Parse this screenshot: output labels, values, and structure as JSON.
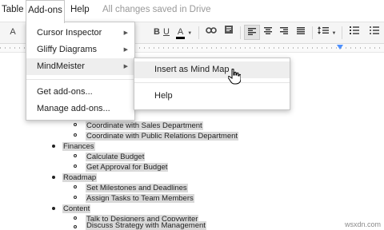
{
  "menubar": {
    "table": "Table",
    "addons": "Add-ons",
    "help": "Help",
    "saved_status": "All changes saved in Drive"
  },
  "toolbar": {
    "font_size_fragment": "A",
    "bold": "B",
    "italic": "I",
    "underline": "U",
    "text_color": "A",
    "active_alignment": "left"
  },
  "addons_menu": {
    "items": [
      {
        "label": "Cursor Inspector",
        "has_submenu": true
      },
      {
        "label": "Gliffy Diagrams",
        "has_submenu": true
      },
      {
        "label": "MindMeister",
        "has_submenu": true,
        "highlighted": true
      },
      {
        "label": "Get add-ons..."
      },
      {
        "label": "Manage add-ons..."
      }
    ]
  },
  "mindmeister_submenu": {
    "items": [
      {
        "label": "Insert as Mind Map",
        "highlighted": true
      },
      {
        "label": "Help"
      }
    ]
  },
  "document": {
    "outline": [
      {
        "level": 2,
        "text": "Coordinate with Sales Department"
      },
      {
        "level": 2,
        "text": "Coordinate with Public Relations Department"
      },
      {
        "level": 1,
        "text": "Finances"
      },
      {
        "level": 2,
        "text": "Calculate Budget"
      },
      {
        "level": 2,
        "text": "Get Approval for Budget"
      },
      {
        "level": 1,
        "text": "Roadmap"
      },
      {
        "level": 2,
        "text": "Set Milestones and Deadlines"
      },
      {
        "level": 2,
        "text": "Assign Tasks to Team Members"
      },
      {
        "level": 1,
        "text": "Content"
      },
      {
        "level": 2,
        "text": "Talk to Designers and Copywriter"
      },
      {
        "level": 2,
        "text": "Discuss Strategy with Management"
      }
    ]
  },
  "watermark": "wsxdn.com",
  "colors": {
    "selection": "#d9d9d9",
    "menu_highlight": "#eeeeee",
    "saved_status": "#999999",
    "ruler_marker": "#4d90fe"
  }
}
